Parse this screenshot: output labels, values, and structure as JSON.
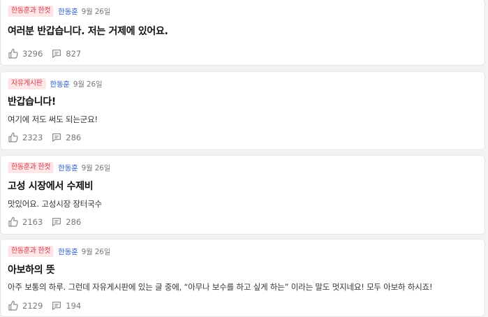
{
  "posts": [
    {
      "category": "한동훈과 한컷",
      "author": "한동훈",
      "date": "9월 26일",
      "title": "여러분 반갑습니다. 저는 거제에 있어요.",
      "body": "",
      "likes": "3296",
      "comments": "827"
    },
    {
      "category": "자유게시판",
      "author": "한동훈",
      "date": "9월 26일",
      "title": "반갑습니다!",
      "body": "여기에 저도 써도 되는군요!",
      "likes": "2323",
      "comments": "286"
    },
    {
      "category": "한동훈과 한컷",
      "author": "한동훈",
      "date": "9월 26일",
      "title": "고성 시장에서 수제비",
      "body": "맛있어요. 고성시장 장터국수",
      "likes": "2163",
      "comments": "286"
    },
    {
      "category": "한동훈과 한컷",
      "author": "한동훈",
      "date": "9월 26일",
      "title": "아보하의 뜻",
      "body": "아주 보통의 하루. 그런데 자유게시판에 있는 글 중에, “아무나 보수를 하고 싶게 하는” 이라는 말도 멋지네요! 모두 아보하 하시죠!",
      "likes": "2129",
      "comments": "194"
    }
  ],
  "icons": {
    "like": "thumbs-up-icon",
    "comment": "comment-icon"
  },
  "colors": {
    "badge_bg": "#fde6e8",
    "badge_text": "#d93a49",
    "author": "#2a5bd7",
    "muted": "#777777"
  }
}
